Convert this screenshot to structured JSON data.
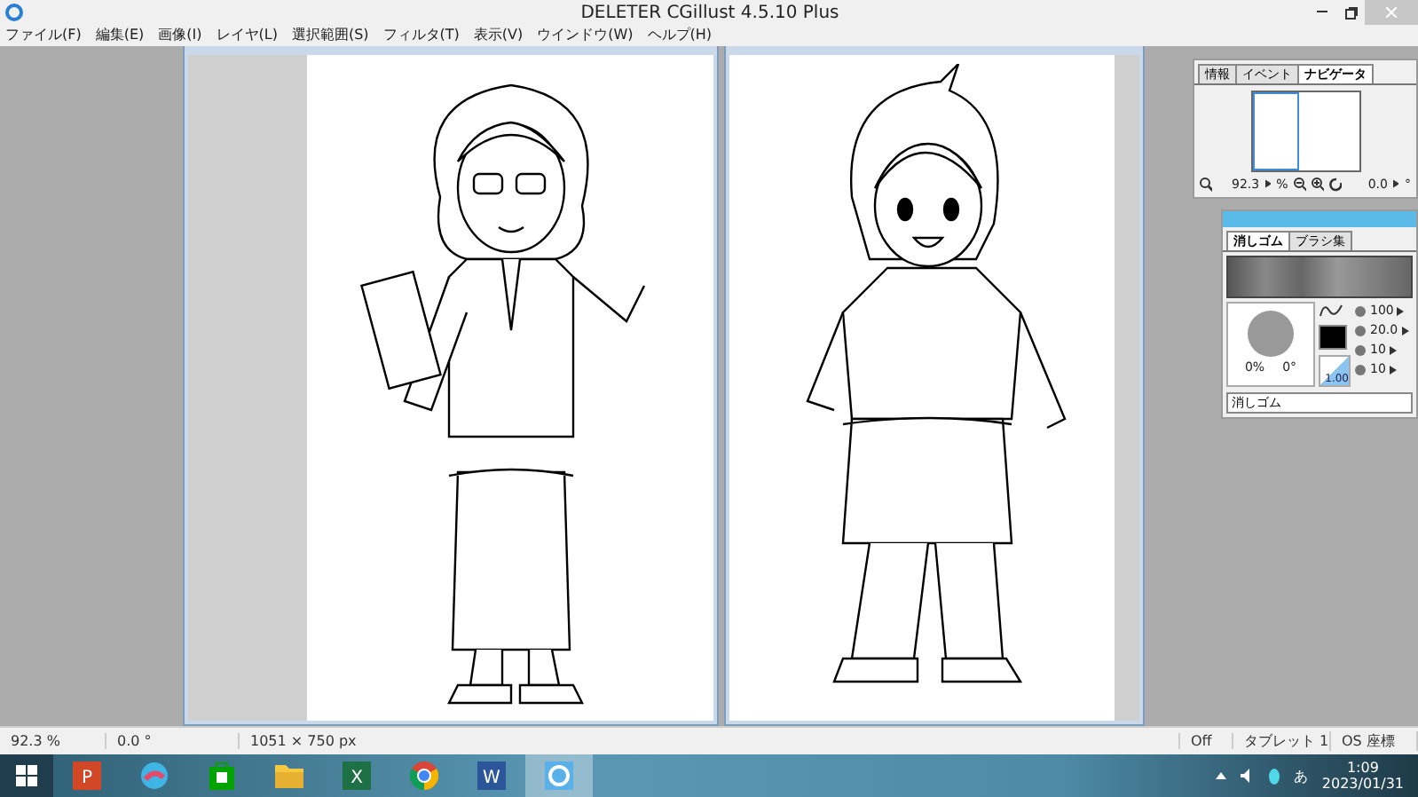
{
  "window": {
    "title": "DELETER CGillust 4.5.10 Plus"
  },
  "menu": [
    "ファイル(F)",
    "編集(E)",
    "画像(I)",
    "レイヤ(L)",
    "選択範囲(S)",
    "フィルタ(T)",
    "表示(V)",
    "ウインドウ(W)",
    "ヘルプ(H)"
  ],
  "navigator": {
    "tabs": [
      {
        "label": "情報",
        "selected": false
      },
      {
        "label": "イベント",
        "selected": false
      },
      {
        "label": "ナビゲータ",
        "selected": true
      }
    ],
    "zoom": "92.3",
    "zoom_unit": "%",
    "angle": "0.0",
    "angle_unit": "°"
  },
  "brush_panel": {
    "tabs": [
      {
        "label": "消しゴム",
        "selected": true
      },
      {
        "label": "ブラシ集",
        "selected": false
      }
    ],
    "sliders": [
      {
        "value": "100"
      },
      {
        "value": "20.0"
      },
      {
        "value": "10"
      },
      {
        "value": "10"
      }
    ],
    "hardness": "0%",
    "tip_angle": "0°",
    "ratio": "1.00",
    "name": "消しゴム"
  },
  "status_bar": {
    "zoom": "92.3 %",
    "angle": "0.0 °",
    "size": "1051 × 750 px",
    "pen": "Off",
    "tablet": "タブレット 1",
    "coords": "OS 座標"
  },
  "taskbar": {
    "apps": [
      {
        "kind": "powerpoint",
        "letter": "P",
        "selected": false
      },
      {
        "kind": "paint",
        "selected": false
      },
      {
        "kind": "store",
        "selected": false
      },
      {
        "kind": "explorer",
        "selected": false
      },
      {
        "kind": "excel",
        "letter": "X",
        "selected": false
      },
      {
        "kind": "chrome",
        "selected": false
      },
      {
        "kind": "word",
        "letter": "W",
        "selected": false
      },
      {
        "kind": "deleter",
        "selected": true
      }
    ],
    "ime": "あ",
    "time": "1:09",
    "date": "2023/01/31"
  }
}
